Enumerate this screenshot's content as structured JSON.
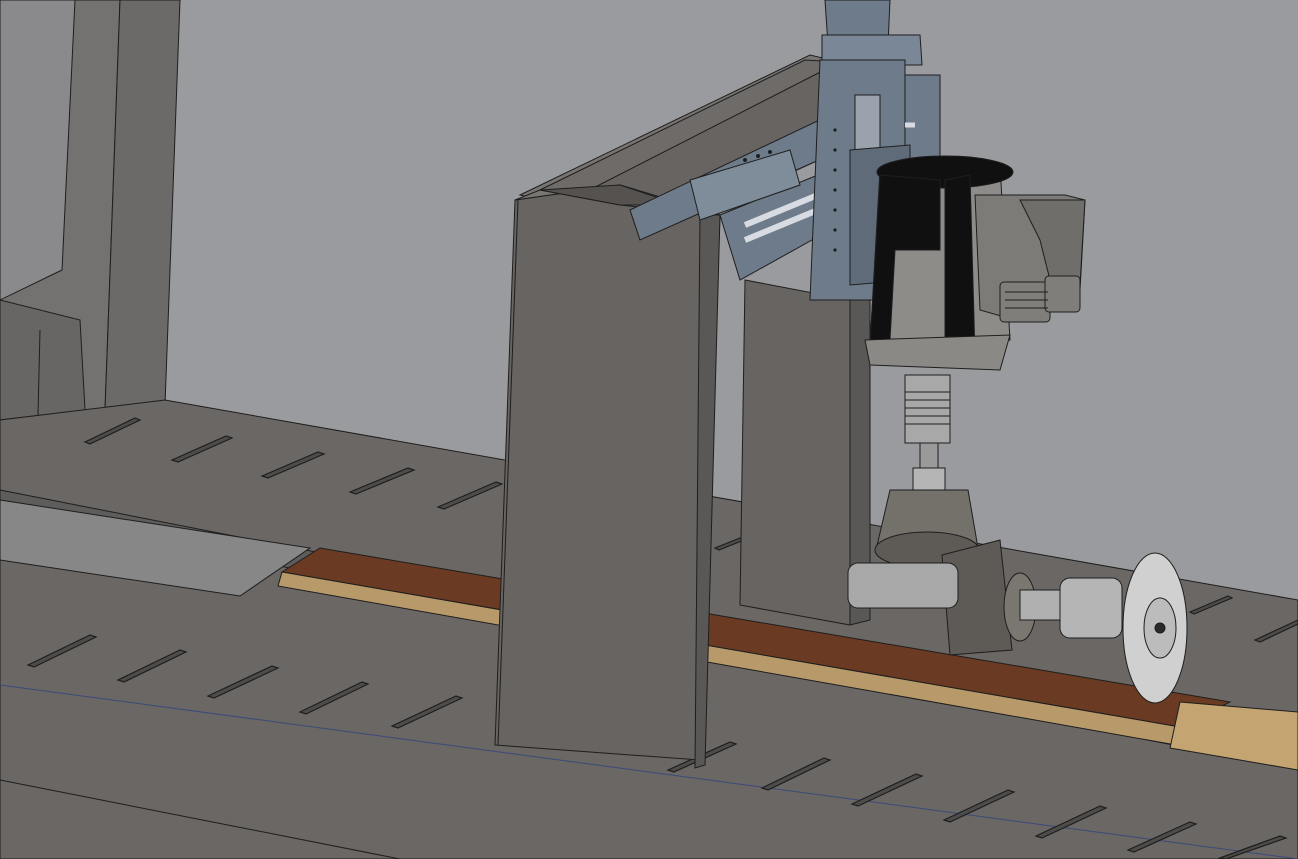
{
  "scene": {
    "name": "cad-viewport",
    "elements": [
      "background-wall",
      "left-frame",
      "slotted-table",
      "wood-workpiece",
      "gantry-frame",
      "linear-axis-x",
      "linear-axis-z",
      "servo-motor",
      "shaft-coupling",
      "bevel-gear-set",
      "cutting-disc"
    ]
  },
  "colors": {
    "wall": "#9a9b9f",
    "frame": "#666360",
    "table": "#6a6764",
    "table_side": "#5f5d5b",
    "steel_blue": "#6e7b8a",
    "motor_body": "#8d8c88",
    "motor_black": "#101010",
    "wood_dark": "#6b3a22",
    "wood_light": "#b89a6a",
    "gear": "#74706a",
    "disc": "#c8c8c8"
  }
}
